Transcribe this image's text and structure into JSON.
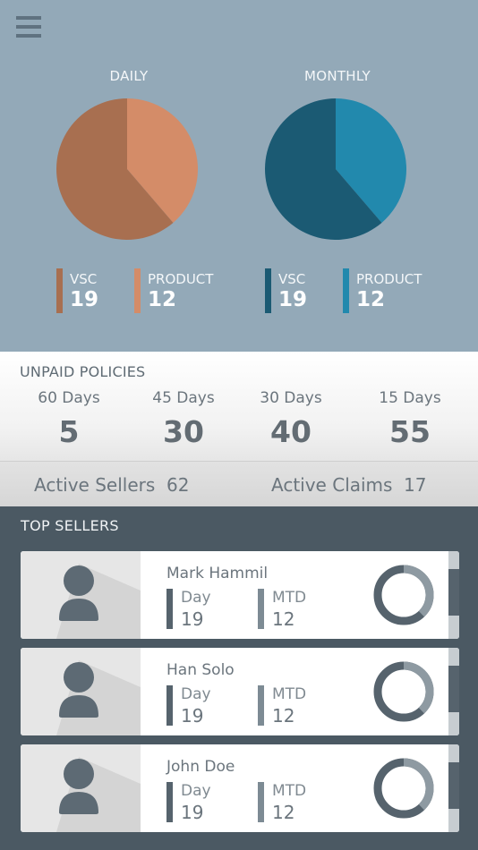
{
  "header": {
    "menu_icon": "hamburger-menu-icon"
  },
  "charts": {
    "daily": {
      "title": "DAILY",
      "legend": [
        {
          "label": "VSC",
          "value": "19",
          "color": "#a86f50"
        },
        {
          "label": "PRODUCT",
          "value": "12",
          "color": "#d48c68"
        }
      ]
    },
    "monthly": {
      "title": "MONTHLY",
      "legend": [
        {
          "label": "VSC",
          "value": "19",
          "color": "#1b5a73"
        },
        {
          "label": "PRODUCT",
          "value": "12",
          "color": "#2289ad"
        }
      ]
    }
  },
  "chart_data": [
    {
      "type": "pie",
      "title": "DAILY",
      "categories": [
        "VSC",
        "PRODUCT"
      ],
      "values": [
        19,
        12
      ],
      "colors": [
        "#a86f50",
        "#d48c68"
      ]
    },
    {
      "type": "pie",
      "title": "MONTHLY",
      "categories": [
        "VSC",
        "PRODUCT"
      ],
      "values": [
        19,
        12
      ],
      "colors": [
        "#1b5a73",
        "#2289ad"
      ]
    }
  ],
  "unpaid": {
    "title": "UNPAID POLICIES",
    "columns": [
      {
        "label": "60 Days",
        "value": "5"
      },
      {
        "label": "45 Days",
        "value": "30"
      },
      {
        "label": "30 Days",
        "value": "40"
      },
      {
        "label": "15 Days",
        "value": "55"
      }
    ]
  },
  "stats": {
    "active_sellers_label": "Active Sellers",
    "active_sellers_value": "62",
    "active_claims_label": "Active Claims",
    "active_claims_value": "17"
  },
  "top_sellers": {
    "title": "TOP SELLERS",
    "sellers": [
      {
        "name": "Mark Hammil",
        "day_label": "Day",
        "day_value": "19",
        "mtd_label": "MTD",
        "mtd_value": "12",
        "progress": 0.38
      },
      {
        "name": "Han Solo",
        "day_label": "Day",
        "day_value": "19",
        "mtd_label": "MTD",
        "mtd_value": "12",
        "progress": 0.38
      },
      {
        "name": "John Doe",
        "day_label": "Day",
        "day_value": "19",
        "mtd_label": "MTD",
        "mtd_value": "12",
        "progress": 0.38
      }
    ]
  },
  "colors": {
    "top_bg": "#93a9b8",
    "bottom_bg": "#4b5963",
    "day_bar": "#56636d",
    "mtd_bar": "#7d8b94",
    "ring_dark": "#56636d",
    "ring_light": "#8e9aa2"
  }
}
